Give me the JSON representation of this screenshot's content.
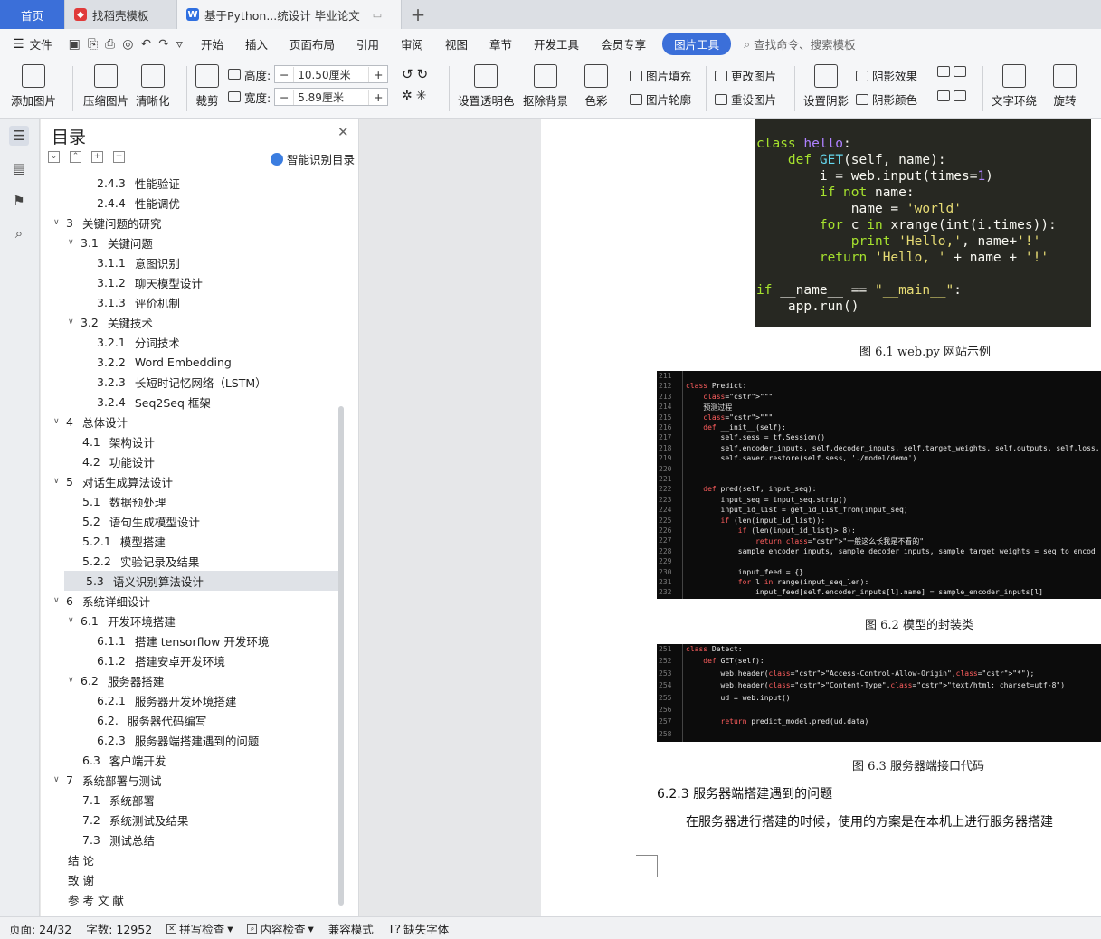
{
  "tabs": {
    "home": "首页",
    "daoke": "找稻壳模板",
    "doc": "基于Python...统设计 毕业论文"
  },
  "menu": {
    "file": "文件",
    "items": [
      "开始",
      "插入",
      "页面布局",
      "引用",
      "审阅",
      "视图",
      "章节",
      "开发工具",
      "会员专享"
    ],
    "active": "图片工具",
    "search": "查找命令、搜索模板"
  },
  "ribbon": {
    "add_image": "添加图片",
    "compress": "压缩图片",
    "clarify": "清晰化",
    "crop": "裁剪",
    "height_label": "高度:",
    "height_value": "10.50厘米",
    "width_label": "宽度:",
    "width_value": "5.89厘米",
    "transparent": "设置透明色",
    "remove_bg": "抠除背景",
    "color": "色彩",
    "fill": "图片填充",
    "outline": "图片轮廓",
    "change": "更改图片",
    "reset": "重设图片",
    "shadow_set": "设置阴影",
    "shadow_effect": "阴影效果",
    "shadow_color": "阴影颜色",
    "wrap": "文字环绕",
    "rotate": "旋转"
  },
  "toc": {
    "title": "目录",
    "smart": "智能识别目录",
    "items": [
      {
        "num": "2.4.3",
        "text": "性能验证"
      },
      {
        "num": "2.4.4",
        "text": "性能调优"
      },
      {
        "num": "3",
        "text": "关键问题的研究"
      },
      {
        "num": "3.1",
        "text": "关键问题"
      },
      {
        "num": "3.1.1",
        "text": "意图识别"
      },
      {
        "num": "3.1.2",
        "text": "聊天模型设计"
      },
      {
        "num": "3.1.3",
        "text": "评价机制"
      },
      {
        "num": "3.2",
        "text": "关键技术"
      },
      {
        "num": "3.2.1",
        "text": "分词技术"
      },
      {
        "num": "3.2.2",
        "text": "Word Embedding"
      },
      {
        "num": "3.2.3",
        "text": "长短时记忆网络（LSTM）"
      },
      {
        "num": "3.2.4",
        "text": "Seq2Seq 框架"
      },
      {
        "num": "4",
        "text": "总体设计"
      },
      {
        "num": "4.1",
        "text": "架构设计"
      },
      {
        "num": "4.2",
        "text": "功能设计"
      },
      {
        "num": "5",
        "text": "对话生成算法设计"
      },
      {
        "num": "5.1",
        "text": "数据预处理"
      },
      {
        "num": "5.2",
        "text": "语句生成模型设计"
      },
      {
        "num": "5.2.1",
        "text": "模型搭建"
      },
      {
        "num": "5.2.2",
        "text": "实验记录及结果"
      },
      {
        "num": "5.3",
        "text": "语义识别算法设计"
      },
      {
        "num": "6",
        "text": "系统详细设计"
      },
      {
        "num": "6.1",
        "text": "开发环境搭建"
      },
      {
        "num": "6.1.1",
        "text": "搭建 tensorflow 开发环境"
      },
      {
        "num": "6.1.2",
        "text": "搭建安卓开发环境"
      },
      {
        "num": "6.2",
        "text": "服务器搭建"
      },
      {
        "num": "6.2.1",
        "text": "服务器开发环境搭建"
      },
      {
        "num": "6.2.",
        "text": "服务器代码编写"
      },
      {
        "num": "6.2.3",
        "text": "服务器端搭建遇到的问题"
      },
      {
        "num": "6.3",
        "text": "客户端开发"
      },
      {
        "num": "7",
        "text": "系统部署与测试"
      },
      {
        "num": "7.1",
        "text": "系统部署"
      },
      {
        "num": "7.2",
        "text": "系统测试及结果"
      },
      {
        "num": "7.3",
        "text": "测试总结"
      },
      {
        "num": "",
        "text": "结  论"
      },
      {
        "num": "",
        "text": "致  谢"
      },
      {
        "num": "",
        "text": "参 考 文 献"
      }
    ]
  },
  "doc": {
    "caption1": "图 6.1 web.py 网站示例",
    "caption2": "图 6.2 模型的封装类",
    "caption3": "图 6.3 服务器端接口代码",
    "heading": "6.2.3   服务器端搭建遇到的问题",
    "para": "在服务器进行搭建的时候，使用的方案是在本机上进行服务器搭建"
  },
  "code2_lines": [
    {
      "n": "211",
      "t": ""
    },
    {
      "n": "212",
      "t": "class Predict:"
    },
    {
      "n": "213",
      "t": "    \"\"\""
    },
    {
      "n": "214",
      "t": "    预测过程"
    },
    {
      "n": "215",
      "t": "    \"\"\""
    },
    {
      "n": "216",
      "t": "    def __init__(self):"
    },
    {
      "n": "217",
      "t": "        self.sess = tf.Session()"
    },
    {
      "n": "218",
      "t": "        self.encoder_inputs, self.decoder_inputs, self.target_weights, self.outputs, self.loss,"
    },
    {
      "n": "219",
      "t": "        self.saver.restore(self.sess, './model/demo')"
    },
    {
      "n": "220",
      "t": ""
    },
    {
      "n": "221",
      "t": ""
    },
    {
      "n": "222",
      "t": "    def pred(self, input_seq):"
    },
    {
      "n": "223",
      "t": "        input_seq = input_seq.strip()"
    },
    {
      "n": "224",
      "t": "        input_id_list = get_id_list_from(input_seq)"
    },
    {
      "n": "225",
      "t": "        if (len(input_id_list)):"
    },
    {
      "n": "226",
      "t": "            if (len(input_id_list)> 8):"
    },
    {
      "n": "227",
      "t": "                return \"一般这么长我是不看的\""
    },
    {
      "n": "228",
      "t": "            sample_encoder_inputs, sample_decoder_inputs, sample_target_weights = seq_to_encod"
    },
    {
      "n": "229",
      "t": ""
    },
    {
      "n": "230",
      "t": "            input_feed = {}"
    },
    {
      "n": "231",
      "t": "            for l in range(input_seq_len):"
    },
    {
      "n": "232",
      "t": "                input_feed[self.encoder_inputs[l].name] = sample_encoder_inputs[l]"
    }
  ],
  "code3_lines": [
    {
      "n": "251",
      "t": "class Detect:"
    },
    {
      "n": "252",
      "t": "    def GET(self):"
    },
    {
      "n": "253",
      "t": "        web.header(\"Access-Control-Allow-Origin\",\"*\");"
    },
    {
      "n": "254",
      "t": "        web.header(\"Content-Type\",\"text/html; charset=utf-8\")"
    },
    {
      "n": "255",
      "t": "        ud = web.input()"
    },
    {
      "n": "256",
      "t": ""
    },
    {
      "n": "257",
      "t": "        return predict_model.pred(ud.data)"
    },
    {
      "n": "258",
      "t": ""
    }
  ],
  "status": {
    "page": "页面: 24/32",
    "words": "字数: 12952",
    "spell": "拼写检查",
    "content": "内容检查",
    "compat": "兼容模式",
    "missing_font": "缺失字体"
  }
}
